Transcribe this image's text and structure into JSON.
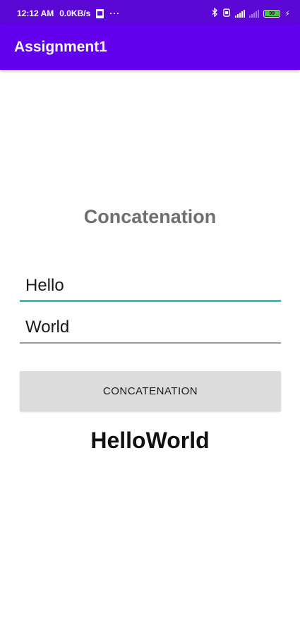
{
  "status_bar": {
    "time": "12:12 AM",
    "network_speed": "0.0KB/s",
    "more": "···",
    "bluetooth_icon": "bluetooth-icon",
    "battery_level": "99",
    "charging_icon": "bolt-icon"
  },
  "app_bar": {
    "title": "Assignment1"
  },
  "main": {
    "heading": "Concatenation",
    "input1": {
      "value": "Hello"
    },
    "input2": {
      "value": "World"
    },
    "button_label": "CONCATENATION",
    "result": "HelloWorld"
  },
  "colors": {
    "status_bar": "#5b07d6",
    "app_bar": "#6200ee",
    "focus_underline": "#2fc4bd",
    "button_bg": "#dcdcdc",
    "heading_text": "#6f6f6f"
  }
}
